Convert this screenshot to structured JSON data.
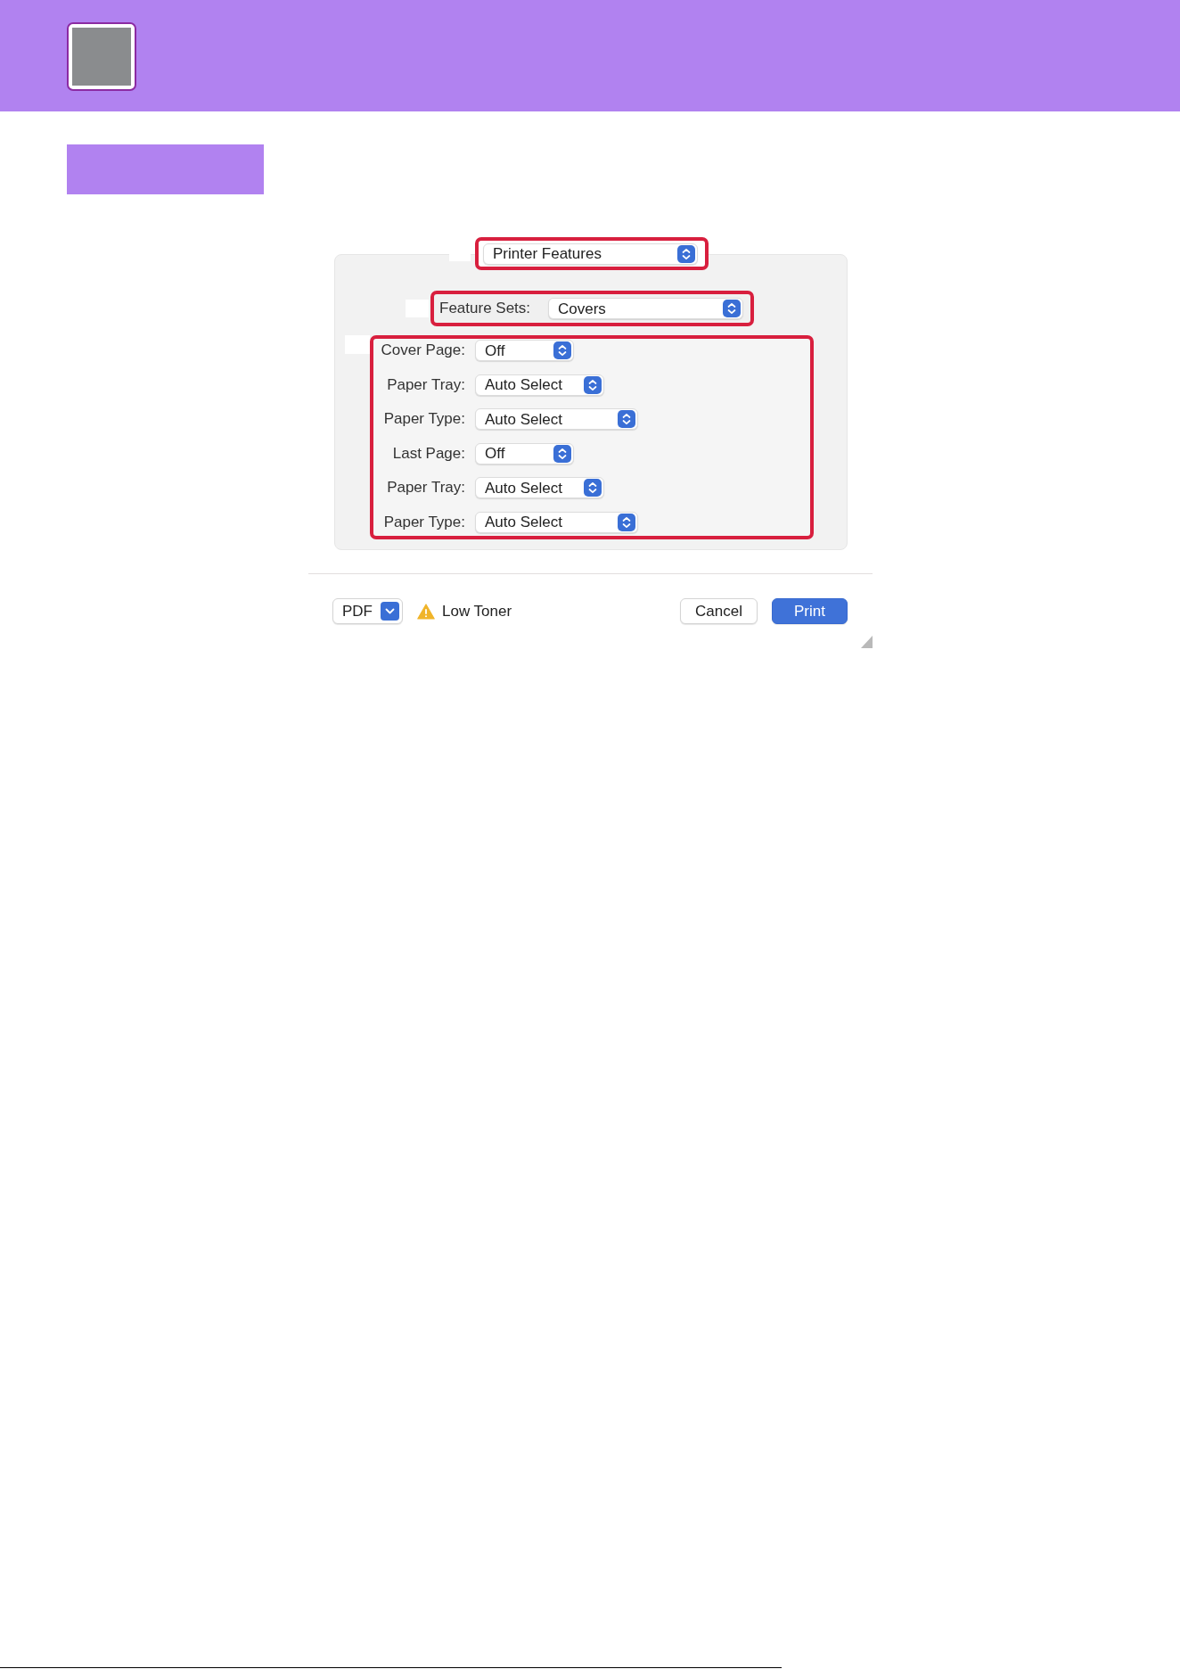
{
  "print_dialog": {
    "preset_menu": {
      "value": "Printer Features",
      "highlighted": true
    },
    "feature_sets": {
      "label": "Feature Sets:",
      "value": "Covers",
      "highlighted": true
    },
    "cover_options": {
      "highlighted": true,
      "rows": [
        {
          "label": "Cover Page:",
          "value": "Off"
        },
        {
          "label": "Paper Tray:",
          "value": "Auto Select"
        },
        {
          "label": "Paper Type:",
          "value": "Auto Select"
        },
        {
          "label": "Last Page:",
          "value": "Off"
        },
        {
          "label": "Paper Tray:",
          "value": "Auto Select"
        },
        {
          "label": "Paper Type:",
          "value": "Auto Select"
        }
      ]
    },
    "pdf_menu": {
      "label": "PDF"
    },
    "status": {
      "text": "Low Toner"
    },
    "buttons": [
      {
        "label": "Cancel",
        "kind": "secondary"
      },
      {
        "label": "Print",
        "kind": "primary"
      }
    ]
  }
}
